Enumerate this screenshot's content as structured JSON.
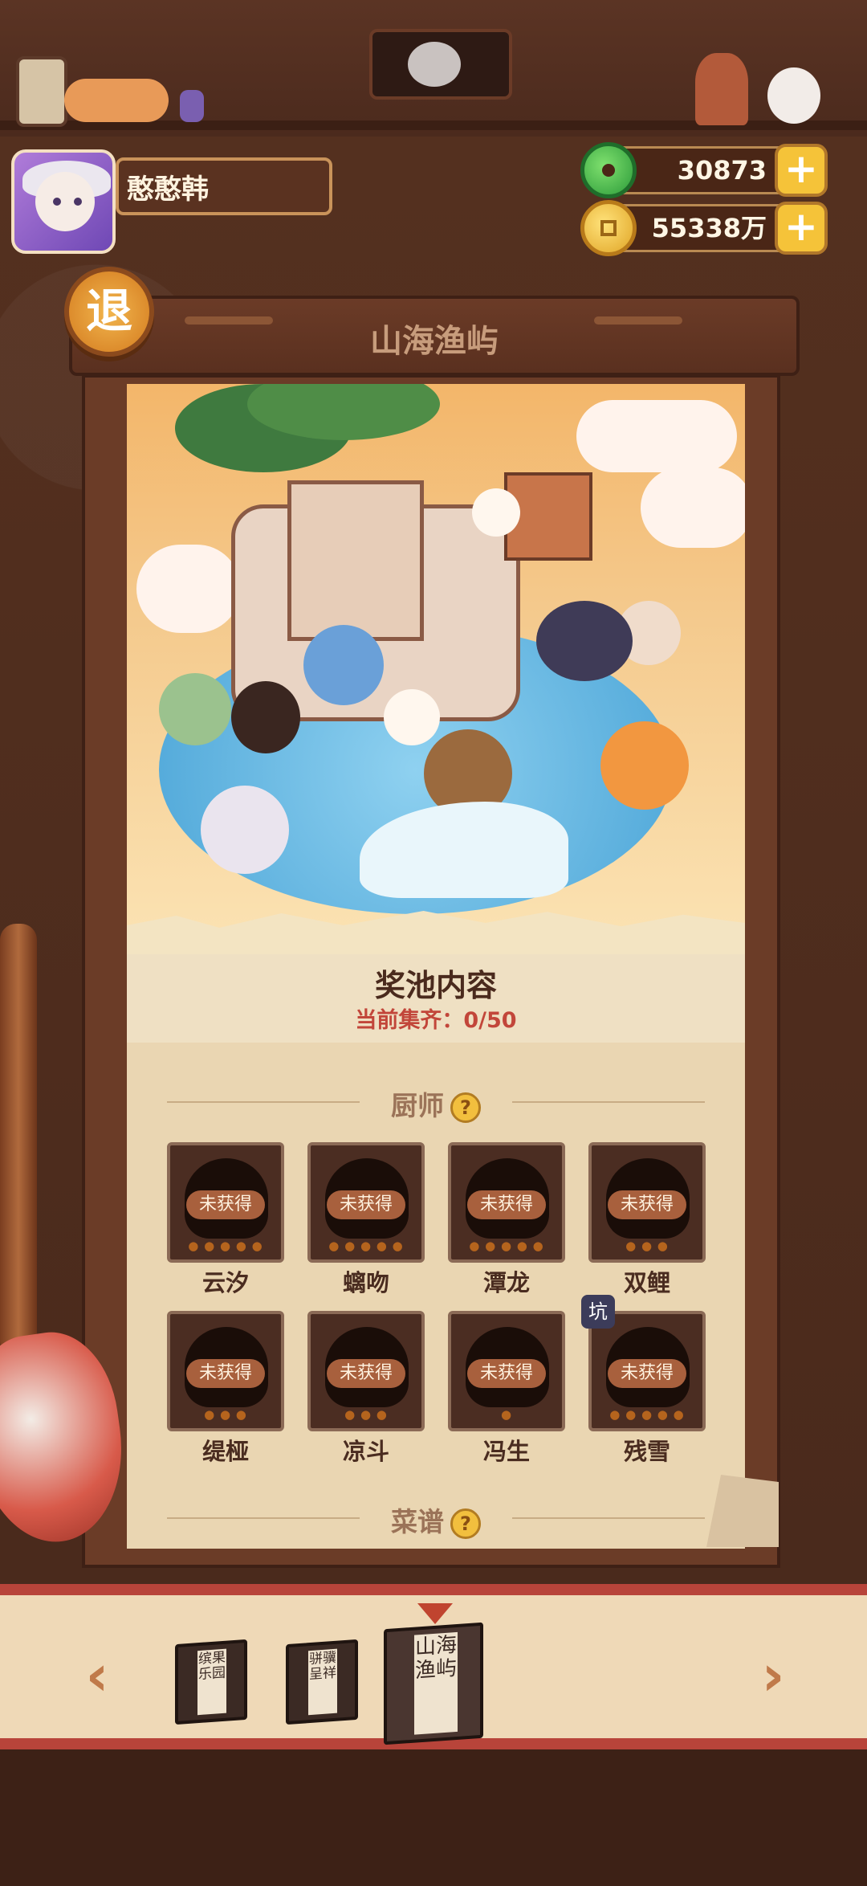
{
  "player": {
    "name": "憨憨韩"
  },
  "currency": {
    "jade": "30873",
    "coins": "55338万",
    "plus": "+"
  },
  "header": {
    "exit_label": "退",
    "title": "山海渔屿"
  },
  "pool": {
    "title": "奖池内容",
    "progress_label": "当前集齐：",
    "progress_value": "0/50"
  },
  "sections": {
    "chefs": {
      "label": "厨师",
      "help": "?"
    },
    "recipes": {
      "label": "菜谱",
      "help": "?"
    }
  },
  "chefs": [
    {
      "name": "云汐",
      "status": "未获得",
      "stars": 5
    },
    {
      "name": "螭吻",
      "status": "未获得",
      "stars": 5
    },
    {
      "name": "潭龙",
      "status": "未获得",
      "stars": 5
    },
    {
      "name": "双鲤",
      "status": "未获得",
      "stars": 3
    },
    {
      "name": "缇桠",
      "status": "未获得",
      "stars": 3
    },
    {
      "name": "凉斗",
      "status": "未获得",
      "stars": 3
    },
    {
      "name": "冯生",
      "status": "未获得",
      "stars": 1
    },
    {
      "name": "残雪",
      "status": "未获得",
      "stars": 5,
      "tag": "坑"
    }
  ],
  "books": [
    {
      "label": "缤果乐园"
    },
    {
      "label": "骈骥呈祥"
    },
    {
      "label": "山海渔屿",
      "selected": true
    }
  ],
  "nav": {
    "prev": "‹",
    "next": "›"
  },
  "colors": {
    "accent": "#c2463a",
    "gold": "#f5c339",
    "panel": "#6b3c27"
  }
}
